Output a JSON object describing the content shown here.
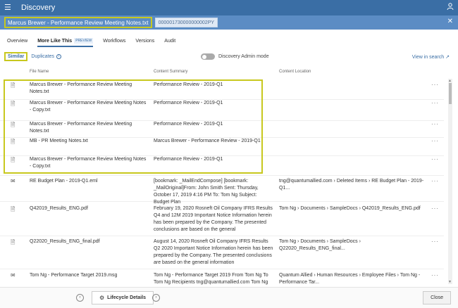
{
  "app": {
    "title": "Discovery",
    "menu_icon": "hamburger-icon",
    "user_icon": "user-icon"
  },
  "document": {
    "title": "Marcus Brewer - Performance Review Meeting Notes.txt",
    "id": "000001730000000002PY",
    "close_icon": "close-icon"
  },
  "tabs": [
    {
      "label": "Overview"
    },
    {
      "label": "More Like This",
      "badge": "PREVIEW",
      "active": true
    },
    {
      "label": "Workflows"
    },
    {
      "label": "Versions"
    },
    {
      "label": "Audit"
    }
  ],
  "subtabs": {
    "similar": "Similar",
    "duplicates": "Duplicates",
    "info_glyph": "i"
  },
  "admin_mode_label": "Discovery Admin mode",
  "view_in_search": "View in search",
  "view_in_search_glyph": "↗",
  "columns": {
    "file_name": "File Name",
    "summary": "Content Summary",
    "location": "Content Location"
  },
  "rows": [
    {
      "icon": "document-icon",
      "name": "Marcus Brewer - Performance Review Meeting Notes.txt",
      "summary": "Performance Review - 2019-Q1",
      "location": ""
    },
    {
      "icon": "document-icon",
      "name": "Marcus Brewer - Performance Review Meeting Notes - Copy.txt",
      "summary": "Performance Review - 2019-Q1",
      "location": ""
    },
    {
      "icon": "document-icon",
      "name": "Marcus Brewer - Performance Review Meeting Notes.txt",
      "summary": "Performance Review - 2019-Q1",
      "location": ""
    },
    {
      "icon": "document-icon",
      "name": "MB - PR Meeting Notes.txt",
      "summary": "Marcus Brewer - Performance Review - 2019-Q1",
      "location": ""
    },
    {
      "icon": "document-icon",
      "name": "Marcus Brewer - Performance Review Meeting Notes - Copy.txt",
      "summary": "Performance Review - 2019-Q1",
      "location": ""
    },
    {
      "icon": "email-icon",
      "name": "RE Budget Plan - 2019-Q1.eml",
      "summary": "[bookmark: _MailEndCompose] [bookmark: _MailOriginal]From: John Smith Sent: Thursday, October 17, 2019 4:16 PM To: Tom Ng Subject: Budget Plan",
      "location": "tng@quantumallied.com  ›  Deleted Items  ›  RE Budget Plan - 2019-Q1..."
    },
    {
      "icon": "document-icon",
      "name": "Q42019_Results_ENG.pdf",
      "summary": "February 19, 2020 Rosneft Oil Company IFRS Results Q4 and 12M 2019 Important Notice Information herein has been prepared by the Company. The presented conclusions are based on the general",
      "location": "Tom Ng  ›  Documents  ›  SampleDocs  ›  Q42019_Results_ENG.pdf"
    },
    {
      "icon": "document-icon",
      "name": "Q22020_Results_ENG_final.pdf",
      "summary": "August 14, 2020 Rosneft Oil Company IFRS Results Q2 2020 Important Notice Information herein has been prepared by the Company. The presented conclusions are based on the general information",
      "location": "Tom Ng  ›  Documents  ›  SampleDocs  ›  Q22020_Results_ENG_final..."
    },
    {
      "icon": "email-icon",
      "name": "Tom Ng - Performance Target 2019.msg",
      "summary": "Tom Ng - Performance Target 2019 From Tom Ng To Tom Ng Recipients tng@quantumallied.com     Tom Ng",
      "location": "Quantum Allied  ›  Human Resources  ›  Employee Files  ›  Tom Ng - Performance Tar..."
    }
  ],
  "row_menu_glyph": "···",
  "footer": {
    "prev_glyph": "‹",
    "next_glyph": "›",
    "lifecycle_label": "Lifecycle Details",
    "lifecycle_icon": "gear-icon",
    "close_label": "Close"
  }
}
